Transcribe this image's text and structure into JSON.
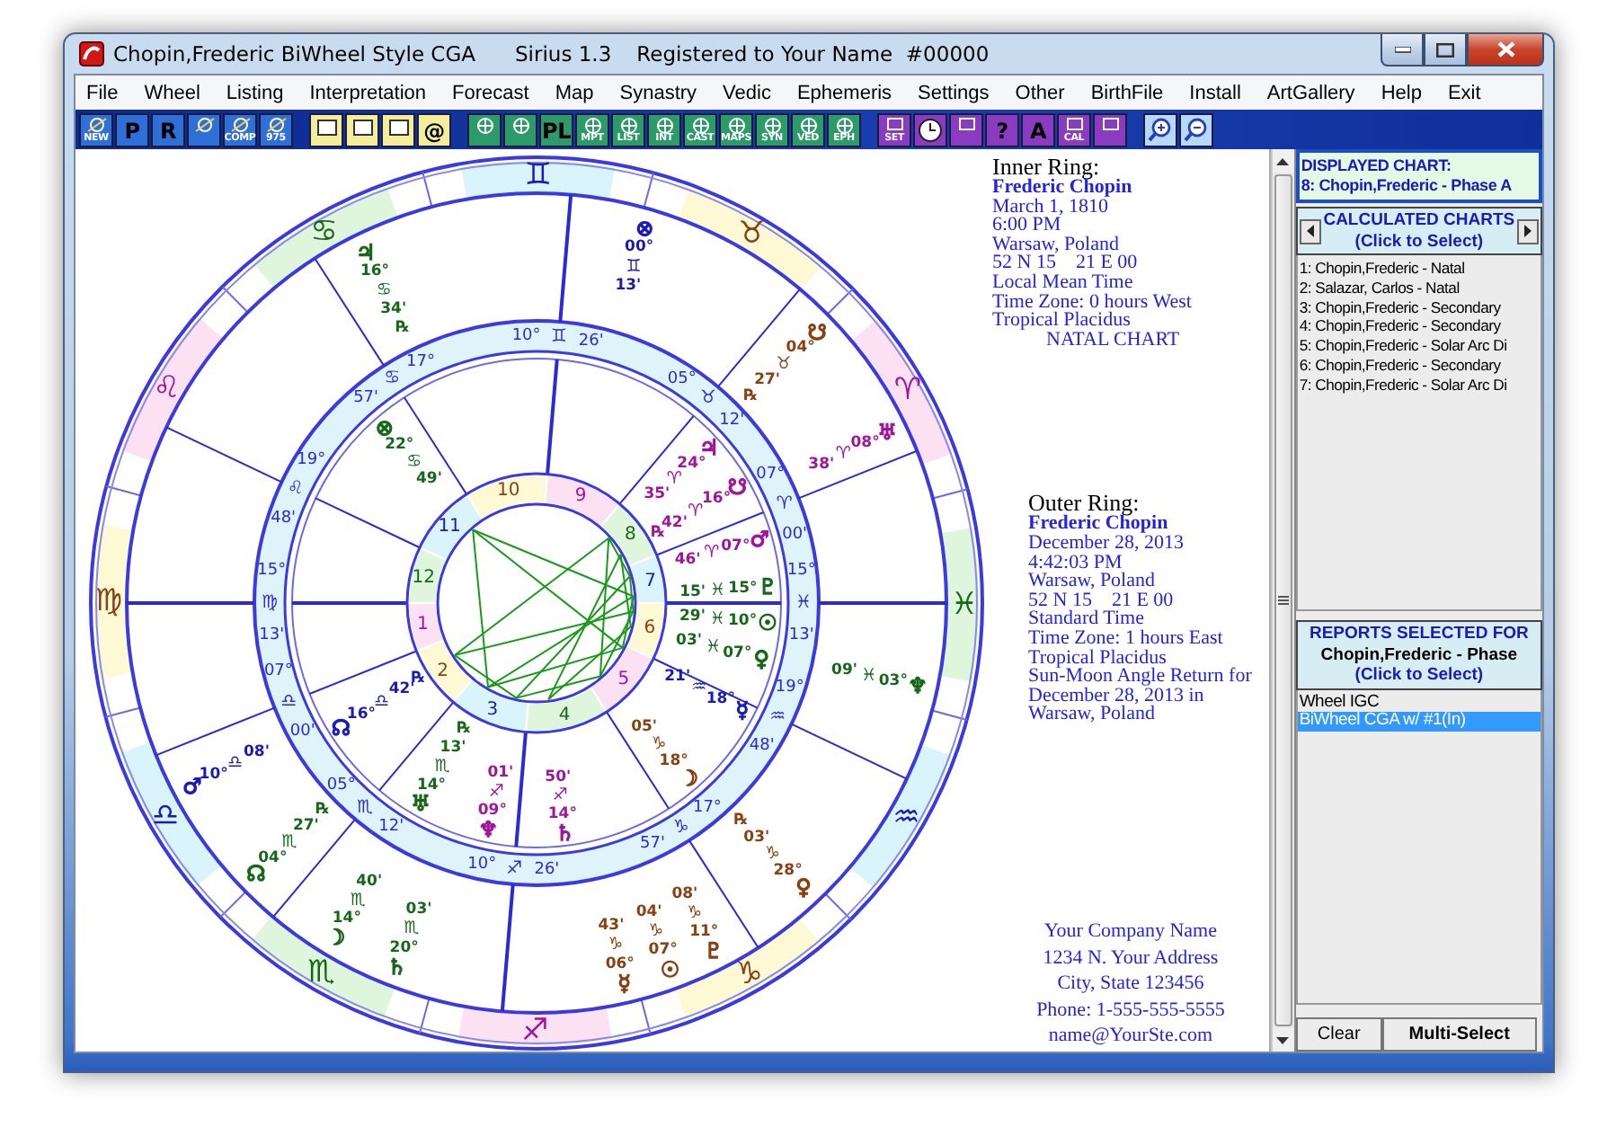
{
  "window": {
    "title": "Chopin,Frederic BiWheel Style CGA",
    "app": "Sirius 1.3",
    "registration": "Registered to Your Name  #00000"
  },
  "menu": [
    "File",
    "Wheel",
    "Listing",
    "Interpretation",
    "Forecast",
    "Map",
    "Synastry",
    "Vedic",
    "Ephemeris",
    "Settings",
    "Other",
    "BirthFile",
    "Install",
    "ArtGallery",
    "Help",
    "Exit"
  ],
  "toolbar": [
    {
      "kind": "chart",
      "label": "NEW"
    },
    {
      "kind": "chart",
      "label": "P"
    },
    {
      "kind": "chart",
      "label": "R"
    },
    {
      "kind": "chart"
    },
    {
      "kind": "chart",
      "label": "COMP"
    },
    {
      "kind": "chart",
      "label": "975"
    },
    {
      "kind": "file"
    },
    {
      "kind": "file"
    },
    {
      "kind": "file"
    },
    {
      "kind": "file",
      "label": "@"
    },
    {
      "kind": "wheel"
    },
    {
      "kind": "wheel"
    },
    {
      "kind": "wheel",
      "label": "PL"
    },
    {
      "kind": "wheel",
      "label": "MPT"
    },
    {
      "kind": "wheel",
      "label": "LIST"
    },
    {
      "kind": "wheel",
      "label": "INT"
    },
    {
      "kind": "wheel",
      "label": "CAST"
    },
    {
      "kind": "wheel",
      "label": "MAPS"
    },
    {
      "kind": "wheel",
      "label": "SYN"
    },
    {
      "kind": "wheel",
      "label": "VED"
    },
    {
      "kind": "wheel",
      "label": "EPH"
    },
    {
      "kind": "tool",
      "label": "SET"
    },
    {
      "kind": "clock"
    },
    {
      "kind": "tool"
    },
    {
      "kind": "tool",
      "label": "?"
    },
    {
      "kind": "tool",
      "label": "A"
    },
    {
      "kind": "tool",
      "label": "CAL"
    },
    {
      "kind": "tool"
    },
    {
      "kind": "zoom_in"
    },
    {
      "kind": "zoom_out"
    }
  ],
  "chart": {
    "zodiac": [
      {
        "sign": "♈",
        "color": "#a0159a"
      },
      {
        "sign": "♉",
        "color": "#8a4010"
      },
      {
        "sign": "♊",
        "color": "#1a1ab8"
      },
      {
        "sign": "♋",
        "color": "#17671a"
      },
      {
        "sign": "♌",
        "color": "#a0159a"
      },
      {
        "sign": "♍",
        "color": "#8a4010"
      },
      {
        "sign": "♎",
        "color": "#1a1ab8"
      },
      {
        "sign": "♏",
        "color": "#17671a"
      },
      {
        "sign": "♐",
        "color": "#a0159a"
      },
      {
        "sign": "♑",
        "color": "#8a4010"
      },
      {
        "sign": "♒",
        "color": "#1a1ab8"
      },
      {
        "sign": "♓",
        "color": "#17671a"
      }
    ],
    "houses": [
      {
        "number": "1",
        "color": "#a0159a"
      },
      {
        "number": "2",
        "color": "#8a4010"
      },
      {
        "number": "3",
        "color": "#1a1ab8"
      },
      {
        "number": "4",
        "color": "#17671a"
      },
      {
        "number": "5",
        "color": "#a0159a"
      },
      {
        "number": "6",
        "color": "#8a4010"
      },
      {
        "number": "7",
        "color": "#1a1ab8"
      },
      {
        "number": "8",
        "color": "#17671a"
      },
      {
        "number": "9",
        "color": "#a0159a"
      },
      {
        "number": "10",
        "color": "#8a4010"
      },
      {
        "number": "11",
        "color": "#1a1ab8"
      },
      {
        "number": "12",
        "color": "#17671a"
      }
    ],
    "cusps": [
      {
        "degree": "10°",
        "sign": "♊",
        "minute": "26'"
      },
      {
        "degree": "17°",
        "sign": "♋",
        "minute": "57'"
      },
      {
        "degree": "05°",
        "sign": "♉",
        "minute": "12'"
      },
      {
        "degree": "19°",
        "sign": "♌",
        "minute": "48'"
      },
      {
        "degree": "07°",
        "sign": "♈",
        "minute": "00'"
      },
      {
        "degree": "15°",
        "sign": "♍",
        "minute": "13'"
      },
      {
        "degree": "15°",
        "sign": "♓",
        "minute": "13'"
      },
      {
        "degree": "07°",
        "sign": "♎",
        "minute": "00'"
      },
      {
        "degree": "19°",
        "sign": "♒",
        "minute": "48'"
      },
      {
        "degree": "05°",
        "sign": "♏",
        "minute": "12'"
      },
      {
        "degree": "17°",
        "sign": "♑",
        "minute": "57'"
      },
      {
        "degree": "10°",
        "sign": "♐",
        "minute": "26'"
      }
    ],
    "inner_planets": [
      {
        "glyph": "⊗",
        "degree": "22°",
        "sign": "♋",
        "minute": "49'",
        "color": "#17671a"
      },
      {
        "glyph": "♃",
        "degree": "24°",
        "sign": "♈",
        "minute": "35'",
        "color": "#a0159a"
      },
      {
        "glyph": "☋",
        "degree": "16°",
        "sign": "♈",
        "minute": "42'",
        "retro": "℞",
        "color": "#a0159a"
      },
      {
        "glyph": "♂",
        "degree": "07°",
        "sign": "♈",
        "minute": "46'",
        "color": "#a0159a"
      },
      {
        "glyph": "♇",
        "degree": "15°",
        "sign": "♓",
        "minute": "15'",
        "color": "#17671a"
      },
      {
        "glyph": "☉",
        "degree": "10°",
        "sign": "♓",
        "minute": "29'",
        "color": "#17671a"
      },
      {
        "glyph": "♀",
        "degree": "07°",
        "sign": "♓",
        "minute": "03'",
        "color": "#17671a"
      },
      {
        "glyph": "☊",
        "degree": "16°",
        "sign": "♎",
        "minute": "42'",
        "retro": "℞",
        "color": "#1a1ab8"
      },
      {
        "glyph": "♅",
        "degree": "14°",
        "sign": "♏",
        "minute": "13'",
        "retro": "℞",
        "color": "#17671a"
      },
      {
        "glyph": "♆",
        "degree": "09°",
        "sign": "♐",
        "minute": "01'",
        "color": "#a0159a"
      },
      {
        "glyph": "♄",
        "degree": "14°",
        "sign": "♐",
        "minute": "50'",
        "color": "#a0159a"
      },
      {
        "glyph": "☽",
        "degree": "18°",
        "sign": "♑",
        "minute": "05'",
        "color": "#8a4010"
      },
      {
        "glyph": "☿",
        "degree": "18°",
        "sign": "♒",
        "minute": "21'",
        "color": "#1a1ab8"
      }
    ],
    "outer_planets": [
      {
        "glyph": "⊗",
        "degree": "00°",
        "sign": "♊",
        "minute": "13'",
        "color": "#1a1ab8"
      },
      {
        "glyph": "♃",
        "degree": "16°",
        "sign": "♋",
        "minute": "34'",
        "retro": "℞",
        "color": "#17671a"
      },
      {
        "glyph": "☋",
        "degree": "04°",
        "sign": "♉",
        "minute": "27'",
        "retro": "℞",
        "color": "#8a4010"
      },
      {
        "glyph": "♅",
        "degree": "08°",
        "sign": "♈",
        "minute": "38'",
        "color": "#a0159a"
      },
      {
        "glyph": "♆",
        "degree": "03°",
        "sign": "♓",
        "minute": "09'",
        "color": "#17671a"
      },
      {
        "glyph": "♂",
        "degree": "10°",
        "sign": "♎",
        "minute": "08'",
        "color": "#1a1ab8"
      },
      {
        "glyph": "♀",
        "degree": "28°",
        "sign": "♑",
        "minute": "03'",
        "retro": "℞",
        "color": "#8a4010"
      },
      {
        "glyph": "☊",
        "degree": "04°",
        "sign": "♏",
        "minute": "27'",
        "retro": "℞",
        "color": "#17671a"
      },
      {
        "glyph": "☽",
        "degree": "14°",
        "sign": "♏",
        "minute": "40'",
        "color": "#17671a"
      },
      {
        "glyph": "♇",
        "degree": "11°",
        "sign": "♑",
        "minute": "08'",
        "color": "#8a4010"
      },
      {
        "glyph": "♄",
        "degree": "20°",
        "sign": "♏",
        "minute": "03'",
        "color": "#17671a"
      },
      {
        "glyph": "☉",
        "degree": "07°",
        "sign": "♑",
        "minute": "04'",
        "color": "#8a4010"
      },
      {
        "glyph": "☿",
        "degree": "06°",
        "sign": "♑",
        "minute": "43'",
        "color": "#8a4010"
      }
    ]
  },
  "inner_ring": {
    "heading": "Inner Ring:",
    "name": "Frederic Chopin",
    "lines": [
      "March 1, 1810",
      "6:00 PM",
      "Warsaw, Poland",
      "52 N 15    21 E 00",
      "Local Mean Time",
      "Time Zone: 0 hours West",
      "Tropical Placidus"
    ],
    "chart_type": "NATAL CHART"
  },
  "outer_ring": {
    "heading": "Outer Ring:",
    "name": "Frederic Chopin",
    "lines": [
      "December 28, 2013",
      "4:42:03 PM",
      "Warsaw, Poland",
      "52 N 15    21 E 00",
      "Standard Time",
      "Time Zone: 1 hours East",
      "Tropical Placidus",
      "Sun-Moon Angle Return for December 28, 2013 in Warsaw, Poland"
    ]
  },
  "company": [
    "Your Company Name",
    "1234 N. Your Address",
    "City, State 123456",
    "Phone: 1-555-555-5555",
    "name@YourSte.com"
  ],
  "displayed_chart": {
    "heading": "DISPLAYED CHART:",
    "value": "8: Chopin,Frederic - Phase A"
  },
  "calculated_charts": {
    "heading": "CALCULATED CHARTS",
    "hint": "(Click to Select)",
    "items": [
      {
        "label": "1: Chopin,Frederic - Natal",
        "selected": false
      },
      {
        "label": "2: Salazar, Carlos - Natal",
        "selected": false
      },
      {
        "label": "3: Chopin,Frederic - Secondary",
        "selected": false
      },
      {
        "label": "4: Chopin,Frederic - Secondary",
        "selected": false
      },
      {
        "label": "5: Chopin,Frederic - Solar Arc Di",
        "selected": false
      },
      {
        "label": "6: Chopin,Frederic - Secondary",
        "selected": false
      },
      {
        "label": "7: Chopin,Frederic - Solar Arc Di",
        "selected": false
      }
    ]
  },
  "reports": {
    "heading": "REPORTS SELECTED FOR",
    "chart": "Chopin,Frederic - Phase",
    "hint": "(Click to Select)",
    "items": [
      {
        "label": "Wheel IGC",
        "selected": false
      },
      {
        "label": "BiWheel CGA w/ #1(In)",
        "selected": true
      }
    ]
  },
  "buttons": [
    {
      "label": "Clear",
      "kind": "normal"
    },
    {
      "label": "Multi-Select",
      "kind": "bold"
    }
  ]
}
